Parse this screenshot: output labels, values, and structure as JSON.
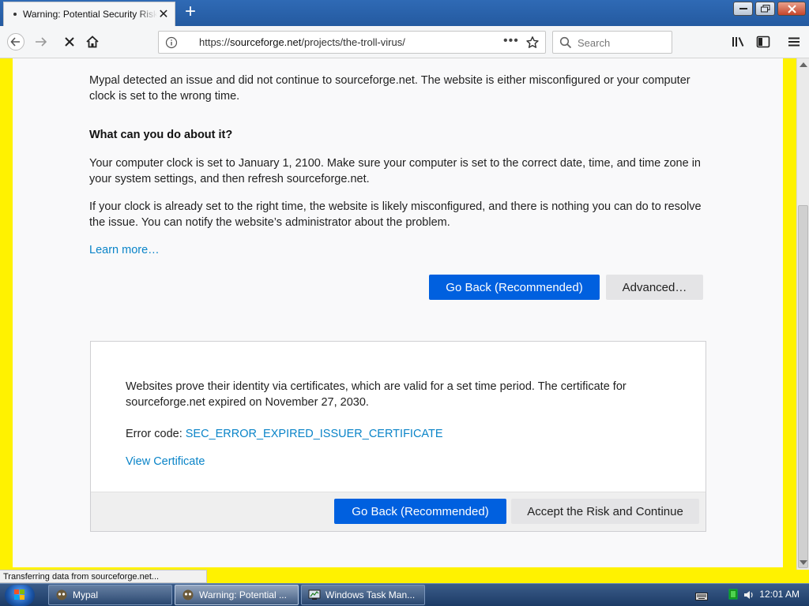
{
  "browser": {
    "tab": {
      "title": "Warning: Potential Security Risk Ahead"
    },
    "url": {
      "prefix": "https://",
      "host": "sourceforge.net",
      "path": "/projects/the-troll-virus/"
    },
    "search": {
      "placeholder": "Search"
    },
    "url_actions": "•••"
  },
  "page": {
    "intro": "Mypal detected an issue and did not continue to sourceforge.net. The website is either misconfigured or your computer clock is set to the wrong time.",
    "heading": "What can you do about it?",
    "para1": "Your computer clock is set to January 1, 2100. Make sure your computer is set to the correct date, time, and time zone in your system settings, and then refresh sourceforge.net.",
    "para2": "If your clock is already set to the right time, the website is likely misconfigured, and there is nothing you can do to resolve the issue. You can notify the website’s administrator about the problem.",
    "learn_more": "Learn more…",
    "go_back": "Go Back (Recommended)",
    "advanced": "Advanced…"
  },
  "advanced_panel": {
    "text": "Websites prove their identity via certificates, which are valid for a set time period. The certificate for sourceforge.net expired on November 27, 2030.",
    "error_label": "Error code: ",
    "error_code": "SEC_ERROR_EXPIRED_ISSUER_CERTIFICATE",
    "view_certificate": "View Certificate",
    "go_back": "Go Back (Recommended)",
    "accept": "Accept the Risk and Continue"
  },
  "status_bar": {
    "text": "Transferring data from sourceforge.net..."
  },
  "taskbar": {
    "items": [
      {
        "label": "Mypal"
      },
      {
        "label": "Warning: Potential ..."
      },
      {
        "label": "Windows Task Man..."
      }
    ],
    "clock": "12:01 AM"
  },
  "colors": {
    "primary_button": "#0060df",
    "link": "#0a84c8",
    "border_highlight": "#fff200"
  }
}
